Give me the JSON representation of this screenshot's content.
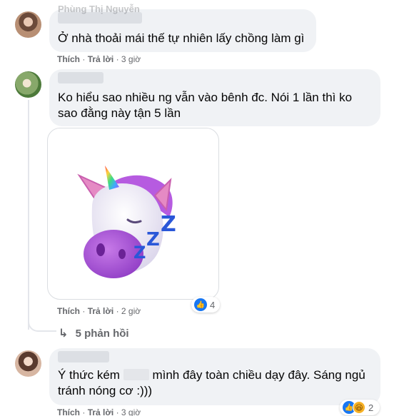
{
  "comments": [
    {
      "author": "Phùng Thị Nguyễn",
      "text": "Ở nhà thoải mái thế tự nhiên lấy chồng làm gì",
      "like_label": "Thích",
      "reply_label": "Trả lời",
      "time": "3 giờ"
    },
    {
      "author": "",
      "text": "Ko hiểu sao nhiều ng vẫn vào bênh đc. Nói 1 lần thì ko sao đằng này tận 5 lần",
      "sticker": "sleeping-unicorn-sticker",
      "like_label": "Thích",
      "reply_label": "Trả lời",
      "time": "2 giờ",
      "reaction_count": "4",
      "replies_label": "5 phản hồi"
    },
    {
      "author": "",
      "text_before": "Ý thức kém",
      "text_after": "mình đây toàn chiều dạy đây. Sáng ngủ tránh nóng cơ :)))",
      "like_label": "Thích",
      "reply_label": "Trả lời",
      "time": "3 giờ",
      "reaction_count": "2"
    }
  ],
  "separator": "·",
  "colors": {
    "bubble": "#f0f2f5",
    "like": "#1877f2",
    "meta": "#65676b"
  }
}
